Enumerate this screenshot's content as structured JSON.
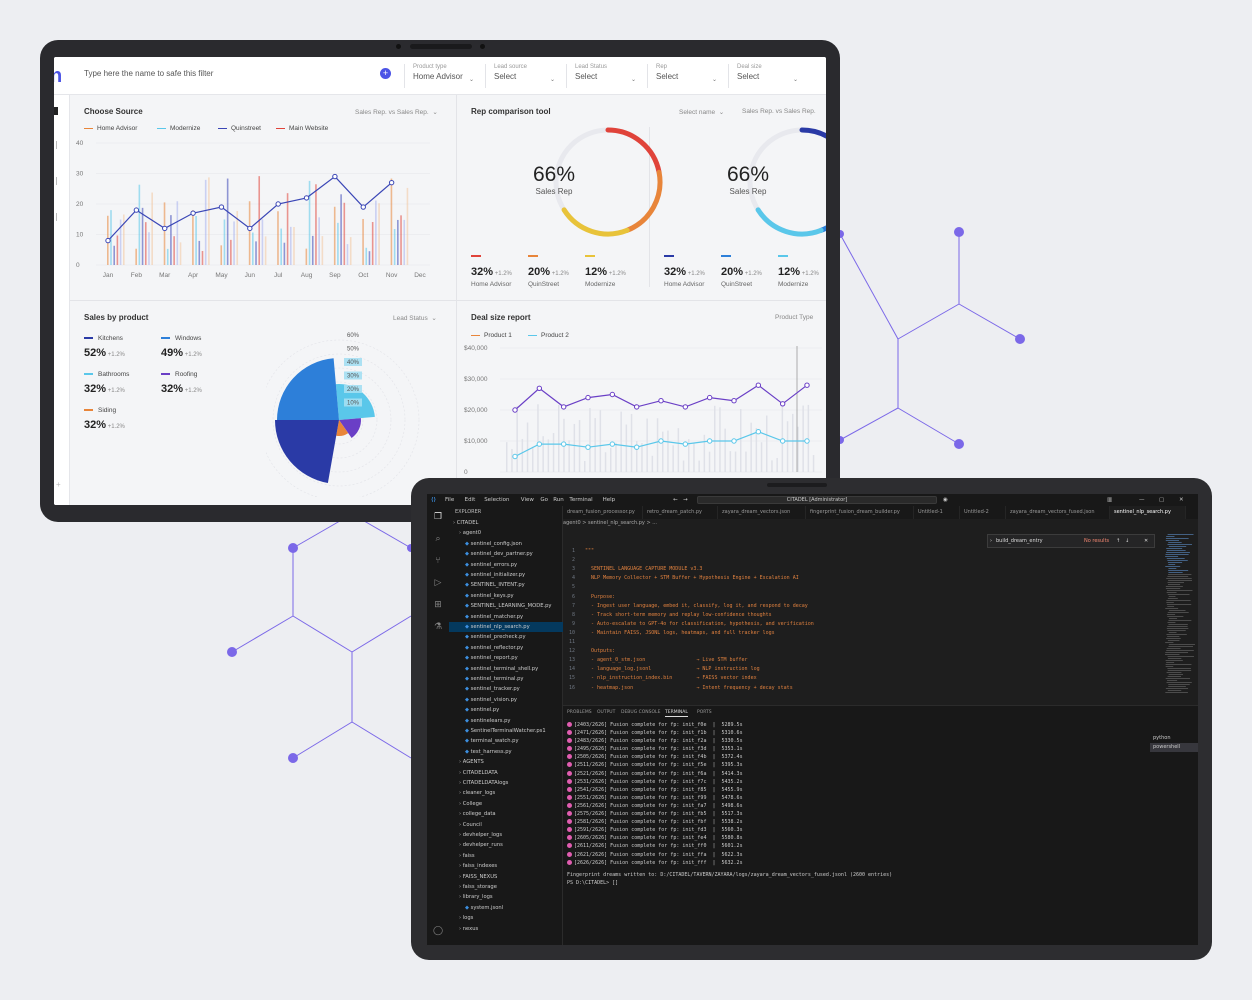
{
  "dashboard": {
    "filter_placeholder": "Type here the name to safe this filter",
    "add_icon": "plus-circle-icon",
    "filters": [
      {
        "label": "Product type",
        "value": "Home Advisor"
      },
      {
        "label": "Lead source",
        "value": "Select"
      },
      {
        "label": "Lead Status",
        "value": "Select"
      },
      {
        "label": "Rep",
        "value": "Select"
      },
      {
        "label": "Deal size",
        "value": "Select"
      }
    ],
    "choose_source": {
      "title": "Choose Source",
      "option": "Sales Rep. vs Sales Rep.",
      "legend": [
        {
          "name": "Home Advisor",
          "color": "#e8853a"
        },
        {
          "name": "Modernize",
          "color": "#5ac7ea"
        },
        {
          "name": "Quinstreet",
          "color": "#3a46b6"
        },
        {
          "name": "Main Website",
          "color": "#e0433a"
        }
      ],
      "y_ticks": [
        "40",
        "30",
        "20",
        "10",
        "0"
      ],
      "months": [
        "Jan",
        "Feb",
        "Mar",
        "Apr",
        "May",
        "Jun",
        "Jul",
        "Aug",
        "Sep",
        "Oct",
        "Nov",
        "Dec"
      ]
    },
    "rep_comparison": {
      "title": "Rep comparison tool",
      "select_name": "Select name",
      "option": "Sales Rep. vs Sales Rep.",
      "donuts": [
        {
          "percent": "66%",
          "label": "Sales Rep",
          "value": 66,
          "colors": [
            "#e0433a",
            "#e8853a",
            "#e8c33a"
          ]
        },
        {
          "percent": "66%",
          "label": "Sales Rep",
          "value": 66,
          "colors": [
            "#2a3aa6",
            "#2d7fd9",
            "#5ac7ea"
          ]
        }
      ],
      "stats_left": [
        {
          "value": "32%",
          "delta": "+1.2%",
          "label": "Home Advisor",
          "color": "#e0433a"
        },
        {
          "value": "20%",
          "delta": "+1.2%",
          "label": "QuinStreet",
          "color": "#e8853a"
        },
        {
          "value": "12%",
          "delta": "+1.2%",
          "label": "Modernize",
          "color": "#e8c33a"
        }
      ],
      "stats_right": [
        {
          "value": "32%",
          "delta": "+1.2%",
          "label": "Home Advisor",
          "color": "#2a3aa6"
        },
        {
          "value": "20%",
          "delta": "+1.2%",
          "label": "QuinStreet",
          "color": "#2d7fd9"
        },
        {
          "value": "12%",
          "delta": "+1.2%",
          "label": "Modernize",
          "color": "#5ac7ea"
        }
      ]
    },
    "sales_by_product": {
      "title": "Sales by product",
      "option": "Lead Status",
      "items": [
        {
          "name": "Kitchens",
          "value": "52%",
          "delta": "+1.2%",
          "color": "#2a3aa6"
        },
        {
          "name": "Windows",
          "value": "49%",
          "delta": "+1.2%",
          "color": "#2d7fd9"
        },
        {
          "name": "Bathrooms",
          "value": "32%",
          "delta": "+1.2%",
          "color": "#5ac7ea"
        },
        {
          "name": "Roofing",
          "value": "32%",
          "delta": "+1.2%",
          "color": "#6a3fc6"
        },
        {
          "name": "Siding",
          "value": "32%",
          "delta": "+1.2%",
          "color": "#e8853a"
        }
      ],
      "rings": [
        "60%",
        "50%",
        "40%",
        "30%",
        "20%",
        "10%"
      ]
    },
    "deal_size": {
      "title": "Deal size report",
      "option": "Product Type",
      "legend": [
        {
          "name": "Product 1",
          "color": "#e8853a"
        },
        {
          "name": "Product 2",
          "color": "#5ac7ea"
        }
      ],
      "y_ticks": [
        "$40,000",
        "$30,000",
        "$20,000",
        "$10,000",
        "0"
      ]
    }
  },
  "vscode": {
    "menu": [
      "File",
      "Edit",
      "Selection",
      "View",
      "Go",
      "Run",
      "Terminal",
      "Help"
    ],
    "command_center": "CITADEL [Administrator]",
    "explorer_title": "EXPLORER",
    "explorer_rows": [
      {
        "text": "CITADEL",
        "indent": 0
      },
      {
        "text": "agent0",
        "indent": 1
      },
      {
        "text": "sentinel_config.json",
        "indent": 2
      },
      {
        "text": "sentinel_dev_partner.py",
        "indent": 2
      },
      {
        "text": "sentinel_errors.py",
        "indent": 2
      },
      {
        "text": "sentinel_initializer.py",
        "indent": 2
      },
      {
        "text": "SENTINEL_INTENT.py",
        "indent": 2
      },
      {
        "text": "sentinel_keys.py",
        "indent": 2
      },
      {
        "text": "SENTINEL_LEARNING_MODE.py",
        "indent": 2
      },
      {
        "text": "sentinel_matcher.py",
        "indent": 2
      },
      {
        "text": "sentinel_nlp_search.py",
        "indent": 2,
        "selected": true
      },
      {
        "text": "sentinel_precheck.py",
        "indent": 2
      },
      {
        "text": "sentinel_reflector.py",
        "indent": 2
      },
      {
        "text": "sentinel_report.py",
        "indent": 2
      },
      {
        "text": "sentinel_terminal_shell.py",
        "indent": 2
      },
      {
        "text": "sentinel_terminal.py",
        "indent": 2
      },
      {
        "text": "sentinel_tracker.py",
        "indent": 2
      },
      {
        "text": "sentinel_vision.py",
        "indent": 2
      },
      {
        "text": "sentinel.py",
        "indent": 2
      },
      {
        "text": "sentinelears.py",
        "indent": 2
      },
      {
        "text": "SentinelTerminalWatcher.ps1",
        "indent": 2
      },
      {
        "text": "terminal_watch.py",
        "indent": 2
      },
      {
        "text": "test_harness.py",
        "indent": 2
      },
      {
        "text": "AGENTS",
        "indent": 1
      },
      {
        "text": "CITADELDATA",
        "indent": 1
      },
      {
        "text": "CITADELDATAlogs",
        "indent": 1
      },
      {
        "text": "cleaner_logs",
        "indent": 1
      },
      {
        "text": "College",
        "indent": 1
      },
      {
        "text": "college_data",
        "indent": 1
      },
      {
        "text": "Council",
        "indent": 1
      },
      {
        "text": "devhelper_logs",
        "indent": 1
      },
      {
        "text": "devhelper_runs",
        "indent": 1
      },
      {
        "text": "faiss",
        "indent": 1
      },
      {
        "text": "faiss_indexes",
        "indent": 1
      },
      {
        "text": "FAISS_NEXUS",
        "indent": 1
      },
      {
        "text": "faiss_storage",
        "indent": 1
      },
      {
        "text": "library_logs",
        "indent": 1
      },
      {
        "text": "system.jsonl",
        "indent": 2
      },
      {
        "text": "logs",
        "indent": 1
      },
      {
        "text": "nexus",
        "indent": 1
      }
    ],
    "tabs": [
      "dream_fusion_processor.py",
      "retro_dream_patch.py",
      "zayara_dream_vectors.json",
      "fingerprint_fusion_dream_builder.py",
      "Untitled-1",
      "Untitled-2",
      "zayara_dream_vectors_fused.json",
      "sentinel_nlp_search.py"
    ],
    "breadcrumb": "agent0 > sentinel_nlp_search.py > ...",
    "find_value": "build_dream_entry",
    "find_result": "No results",
    "code_lines": [
      "\"\"\"",
      "",
      "  SENTINEL LANGUAGE CAPTURE MODULE v3.3",
      "  NLP Memory Collector + STM Buffer + Hypothesis Engine + Escalation AI",
      "",
      "  Purpose:",
      "  - Ingest user language, embed it, classify, log it, and respond to decay",
      "  - Track short-term memory and replay low-confidence thoughts",
      "  - Auto-escalate to GPT-4o for classification, hypothesis, and verification",
      "  - Maintain FAISS, JSONL logs, heatmaps, and full tracker logs",
      "",
      "  Outputs:",
      "  - agent_0_stm.json                 → Live STM buffer",
      "  - language_log.jsonl               → NLP instruction log",
      "  - nlp_instruction_index.bin        → FAISS vector index",
      "  - heatmap.json                     → Intent frequency + decay stats"
    ],
    "panel_tabs": [
      "PROBLEMS",
      "OUTPUT",
      "DEBUG CONSOLE",
      "TERMINAL",
      "PORTS"
    ],
    "terminal_lines": [
      "[2403/2626] Fusion complete for fp: init_f0e  |  5289.5s",
      "[2471/2626] Fusion complete for fp: init_f1b  |  5310.6s",
      "[2483/2626] Fusion complete for fp: init_f2a  |  5330.5s",
      "[2495/2626] Fusion complete for fp: init_f3d  |  5353.1s",
      "[2505/2626] Fusion complete for fp: init_f4b  |  5372.4s",
      "[2511/2626] Fusion complete for fp: init_f5e  |  5395.3s",
      "[2521/2626] Fusion complete for fp: init_f6a  |  5414.3s",
      "[2531/2626] Fusion complete for fp: init_f7c  |  5435.2s",
      "[2541/2626] Fusion complete for fp: init_f85  |  5455.9s",
      "[2551/2626] Fusion complete for fp: init_f99  |  5478.6s",
      "[2561/2626] Fusion complete for fp: init_fa7  |  5498.6s",
      "[2575/2626] Fusion complete for fp: init_fb5  |  5517.3s",
      "[2581/2626] Fusion complete for fp: init_fbf  |  5538.2s",
      "[2591/2626] Fusion complete for fp: init_fd3  |  5560.3s",
      "[2605/2626] Fusion complete for fp: init_fe4  |  5580.8s",
      "[2611/2626] Fusion complete for fp: init_ff0  |  5601.2s",
      "[2621/2626] Fusion complete for fp: init_ffa  |  5622.3s",
      "[2626/2626] Fusion complete for fp: init_fff  |  5632.2s"
    ],
    "terminal_footer": "Fingerprint dreams written to: D:/CITADEL/TAVERN/ZAYARA/logs/zayara_dream_vectors_fused.jsonl (2600 entries)",
    "prompt": "PS D:\\CITADEL> ",
    "terminals": [
      "python",
      "powershell"
    ]
  }
}
